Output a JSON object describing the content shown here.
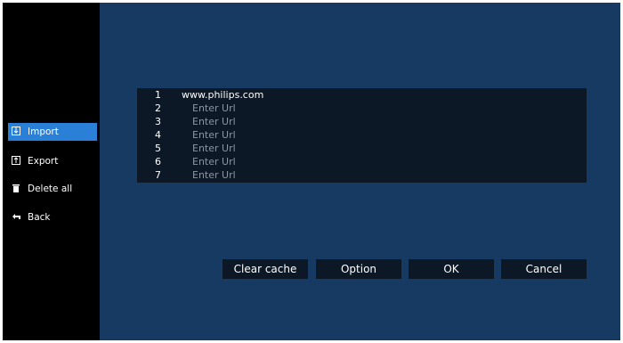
{
  "sidebar": {
    "items": [
      {
        "label": "Import",
        "icon": "import-icon"
      },
      {
        "label": "Export",
        "icon": "export-icon"
      },
      {
        "label": "Delete all",
        "icon": "trash-icon"
      },
      {
        "label": "Back",
        "icon": "back-arrow-icon"
      }
    ],
    "active_index": 0
  },
  "url_list": {
    "rows": [
      {
        "number": "1",
        "value": "www.philips.com",
        "placeholder": ""
      },
      {
        "number": "2",
        "value": "",
        "placeholder": "Enter Url"
      },
      {
        "number": "3",
        "value": "",
        "placeholder": "Enter Url"
      },
      {
        "number": "4",
        "value": "",
        "placeholder": "Enter Url"
      },
      {
        "number": "5",
        "value": "",
        "placeholder": "Enter Url"
      },
      {
        "number": "6",
        "value": "",
        "placeholder": "Enter Url"
      },
      {
        "number": "7",
        "value": "",
        "placeholder": "Enter Url"
      }
    ]
  },
  "buttons": {
    "clear_cache": "Clear cache",
    "option": "Option",
    "ok": "OK",
    "cancel": "Cancel"
  },
  "colors": {
    "main_bg": "#163a62",
    "active_item": "#2a7fd6",
    "panel_bg": "#0d1826"
  }
}
